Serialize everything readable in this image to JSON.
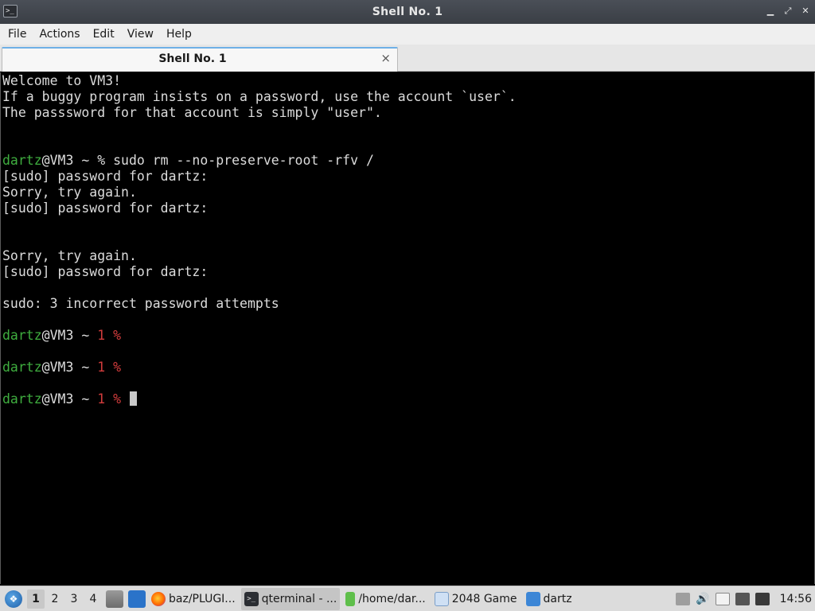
{
  "window": {
    "title": "Shell No. 1",
    "app_icon": "terminal-icon",
    "controls": [
      "minimize-icon",
      "maximize-icon",
      "close-icon"
    ]
  },
  "menu": [
    "File",
    "Actions",
    "Edit",
    "View",
    "Help"
  ],
  "tabs": [
    {
      "label": "Shell No. 1",
      "close": "×"
    }
  ],
  "terminal": {
    "lines": [
      {
        "segments": [
          {
            "text": "Welcome to VM3!",
            "style": "normal"
          }
        ]
      },
      {
        "segments": [
          {
            "text": "If a buggy program insists on a password, use the account `user`.",
            "style": "normal"
          }
        ]
      },
      {
        "segments": [
          {
            "text": "The passsword for that account is simply \"user\".",
            "style": "normal"
          }
        ]
      },
      {
        "segments": []
      },
      {
        "segments": []
      },
      {
        "segments": [
          {
            "text": "dartz",
            "style": "user"
          },
          {
            "text": "@VM3 ~ % sudo rm --no-preserve-root -rfv /",
            "style": "normal"
          }
        ]
      },
      {
        "segments": [
          {
            "text": "[sudo] password for dartz:",
            "style": "normal"
          }
        ]
      },
      {
        "segments": [
          {
            "text": "Sorry, try again.",
            "style": "normal"
          }
        ]
      },
      {
        "segments": [
          {
            "text": "[sudo] password for dartz:",
            "style": "normal"
          }
        ]
      },
      {
        "segments": []
      },
      {
        "segments": []
      },
      {
        "segments": [
          {
            "text": "Sorry, try again.",
            "style": "normal"
          }
        ]
      },
      {
        "segments": [
          {
            "text": "[sudo] password for dartz:",
            "style": "normal"
          }
        ]
      },
      {
        "segments": []
      },
      {
        "segments": [
          {
            "text": "sudo: 3 incorrect password attempts",
            "style": "normal"
          }
        ]
      },
      {
        "segments": []
      },
      {
        "segments": [
          {
            "text": "dartz",
            "style": "user"
          },
          {
            "text": "@VM3 ~ ",
            "style": "normal"
          },
          {
            "text": "1 %",
            "style": "err"
          }
        ]
      },
      {
        "segments": []
      },
      {
        "segments": [
          {
            "text": "dartz",
            "style": "user"
          },
          {
            "text": "@VM3 ~ ",
            "style": "normal"
          },
          {
            "text": "1 %",
            "style": "err"
          }
        ]
      },
      {
        "segments": []
      },
      {
        "segments": [
          {
            "text": "dartz",
            "style": "user"
          },
          {
            "text": "@VM3 ~ ",
            "style": "normal"
          },
          {
            "text": "1 % ",
            "style": "err"
          }
        ],
        "cursor": true
      }
    ]
  },
  "taskbar": {
    "desktops": [
      "1",
      "2",
      "3",
      "4"
    ],
    "active_desktop": "1",
    "tasks": [
      {
        "label": "baz/PLUGI...",
        "icon": "firefox-icon"
      },
      {
        "label": "qterminal - ...",
        "icon": "terminal-icon",
        "active": true
      },
      {
        "label": "/home/dar...",
        "icon": "text-file-icon"
      },
      {
        "label": "2048 Game",
        "icon": "game-window-icon"
      },
      {
        "label": "dartz",
        "icon": "folder-icon"
      }
    ],
    "clock": "14:56"
  },
  "colors": {
    "user": "#3fae3f",
    "error": "#d23c3c",
    "terminal_bg": "#000000",
    "terminal_fg": "#dcdcdc"
  }
}
